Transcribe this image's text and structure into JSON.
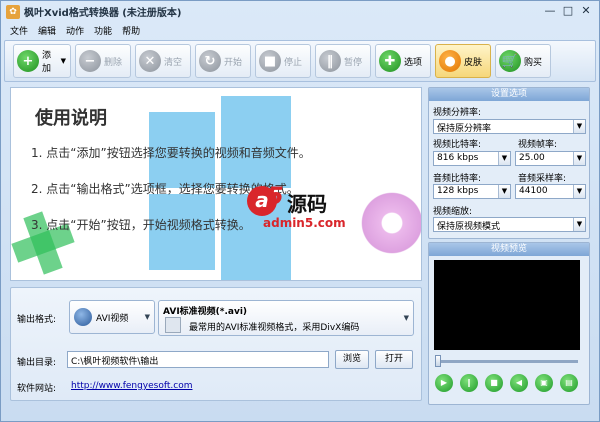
{
  "titlebar": {
    "title": "枫叶Xvid格式转换器  (未注册版本)"
  },
  "menu": [
    "文件",
    "编辑",
    "动作",
    "功能",
    "帮助"
  ],
  "toolbar": {
    "add": "添加",
    "remove": "删除",
    "clear": "清空",
    "start": "开始",
    "stop": "停止",
    "pause": "暂停",
    "options": "选项",
    "skin": "皮肤",
    "buy": "购买"
  },
  "intro": {
    "title": "使用说明",
    "steps": [
      "1. 点击“添加”按钮选择您要转换的视频和音频文件。",
      "2. 点击“输出格式”选项框，选择您要转换的格式。",
      "3. 点击“开始”按钮，开始视频格式转换。"
    ],
    "watermark_cn": "源码",
    "watermark_url": "admin5.com"
  },
  "output": {
    "format_label": "输出格式:",
    "format_value": "AVI视频",
    "format_title": "AVI标准视频(*.avi)",
    "format_desc": "最常用的AVI标准视频格式，采用DivX编码",
    "dir_label": "输出目录:",
    "dir_value": "C:\\枫叶视频软件\\输出",
    "browse": "浏览",
    "open": "打开",
    "site_label": "软件网站:",
    "site_url": "http://www.fengyesoft.com"
  },
  "settings": {
    "header": "设置选项",
    "resolution_label": "视频分辨率:",
    "resolution_value": "保持原分辨率",
    "vbitrate_label": "视频比特率:",
    "vbitrate_value": "816 kbps",
    "framerate_label": "视频帧率:",
    "framerate_value": "25.00",
    "abitrate_label": "音频比特率:",
    "abitrate_value": "128 kbps",
    "samplerate_label": "音频采样率:",
    "samplerate_value": "44100",
    "scale_label": "视频缩放:",
    "scale_value": "保持原视频模式"
  },
  "preview": {
    "header": "视频预览"
  }
}
